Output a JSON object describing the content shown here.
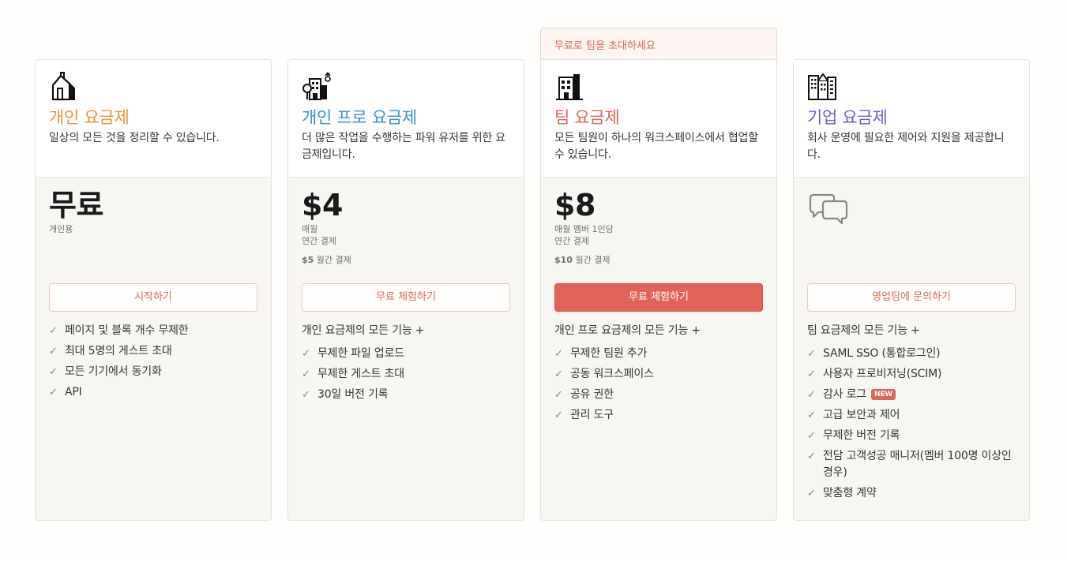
{
  "banner": {
    "text": "무료로 팀을 초대하세요"
  },
  "colors": {
    "personal": "#e8943a",
    "pro": "#3d8fd4",
    "team": "#e0645a",
    "enterprise": "#6c5fd4",
    "accent": "#e0645a"
  },
  "plans": [
    {
      "icon": "house-icon",
      "title": "개인 요금제",
      "desc": "일상의 모든 것을 정리할 수 있습니다.",
      "price": "무료",
      "price_note1": "개인용",
      "cta": "시작하기",
      "features": [
        "페이지 및 블록 개수 무제한",
        "최대 5명의 게스트 초대",
        "모든 기기에서 동기화",
        "API"
      ]
    },
    {
      "icon": "building-tree-icon",
      "title": "개인 프로 요금제",
      "desc": "더 많은 작업을 수행하는 파워 유저를 위한 요금제입니다.",
      "price": "$4",
      "price_note1": "매월",
      "price_note2": "연간 결제",
      "monthly_amount": "$5",
      "monthly_label": " 월간 결제",
      "cta": "무료 체험하기",
      "intro": "개인 요금제의 모든 기능 +",
      "features": [
        "무제한 파일 업로드",
        "무제한 게스트 초대",
        "30일 버전 기록"
      ]
    },
    {
      "icon": "office-building-icon",
      "title": "팀 요금제",
      "desc": "모든 팀원이 하나의 워크스페이스에서 협업할 수 있습니다.",
      "price": "$8",
      "price_note1": "매월 멤버 1인당",
      "price_note2": "연간 결제",
      "monthly_amount": "$10",
      "monthly_label": " 월간 결제",
      "cta": "무료 체험하기",
      "intro": "개인 프로 요금제의 모든 기능 +",
      "features": [
        "무제한 팀원 추가",
        "공동 워크스페이스",
        "공유 권한",
        "관리 도구"
      ]
    },
    {
      "icon": "city-buildings-icon",
      "title": "기업 요금제",
      "desc": "회사 운영에 필요한 제어와 지원을 제공합니다.",
      "price_icon": "chat-bubbles-icon",
      "cta": "영업팀에 문의하기",
      "intro": "팀 요금제의 모든 기능 +",
      "features": [
        "SAML SSO (통합로그인)",
        "사용자 프로비저닝(SCIM)",
        "감사 로그",
        "고급 보안과 제어",
        "무제한 버전 기록",
        "전담 고객성공 매니저(멤버 100명 이상인 경우)",
        "맞춤형 계약"
      ],
      "new_badge": "NEW"
    }
  ]
}
